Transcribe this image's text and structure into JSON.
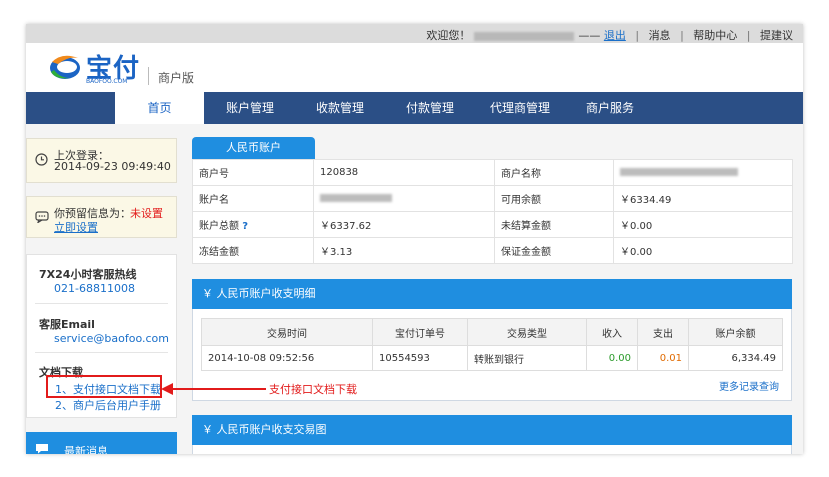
{
  "topbar": {
    "welcome": "欢迎您！",
    "dashes": "——",
    "logout": "退出",
    "messages": "消息",
    "help": "帮助中心",
    "suggest": "提建议",
    "sep": "|"
  },
  "header": {
    "logo_text": "宝付",
    "logo_sub": "BAOFOO.COM",
    "edition": "商户版"
  },
  "nav": {
    "items": [
      "首页",
      "账户管理",
      "收款管理",
      "付款管理",
      "代理商管理",
      "商户服务"
    ]
  },
  "sidebar": {
    "last_login_label": "上次登录：",
    "last_login_time": "2014-09-23 09:49:40",
    "reserved_info_label": "你预留信息为：",
    "reserved_info_status": "未设置",
    "reserved_info_link": "立即设置",
    "hotline_label": "7X24小时客服热线",
    "hotline_number": "021-68811008",
    "email_label": "客服Email",
    "email_value": "service@baofoo.com",
    "docs_label": "文档下载",
    "doc_items": [
      "1、支付接口文档下载",
      "2、商户后台用户手册"
    ],
    "latest_label": "最新消息"
  },
  "account": {
    "tab": "人民币账户",
    "rows": [
      {
        "k1": "商户号",
        "v1": "120838",
        "k2": "商户名称",
        "v2": ""
      },
      {
        "k1": "账户名",
        "v1": "",
        "k2": "可用余额",
        "v2": "￥6334.49"
      },
      {
        "k1": "账户总额",
        "q": "?",
        "v1": "￥6337.62",
        "k2": "未结算金额",
        "v2": "￥0.00"
      },
      {
        "k1": "冻结金额",
        "v1": "￥3.13",
        "k2": "保证金金额",
        "v2": "￥0.00"
      }
    ]
  },
  "detail": {
    "title": "￥ 人民币账户收支明细",
    "headers": [
      "交易时间",
      "宝付订单号",
      "交易类型",
      "收入",
      "支出",
      "账户余额"
    ],
    "rows": [
      {
        "time": "2014-10-08 09:52:56",
        "order": "10554593",
        "type": "转账到银行",
        "income": "0.00",
        "expense": "0.01",
        "balance": "6,334.49"
      }
    ],
    "more": "更多记录查询"
  },
  "chart_panel": {
    "title": "￥ 人民币账户收支交易图"
  },
  "annotation": {
    "text": "支付接口文档下载"
  },
  "colors": {
    "nav_bg": "#2b4f86",
    "accent_blue": "#1f8ee0",
    "annotation_red": "#e21b1b",
    "income_green": "#2a9a2a",
    "expense_orange": "#e06a00"
  }
}
